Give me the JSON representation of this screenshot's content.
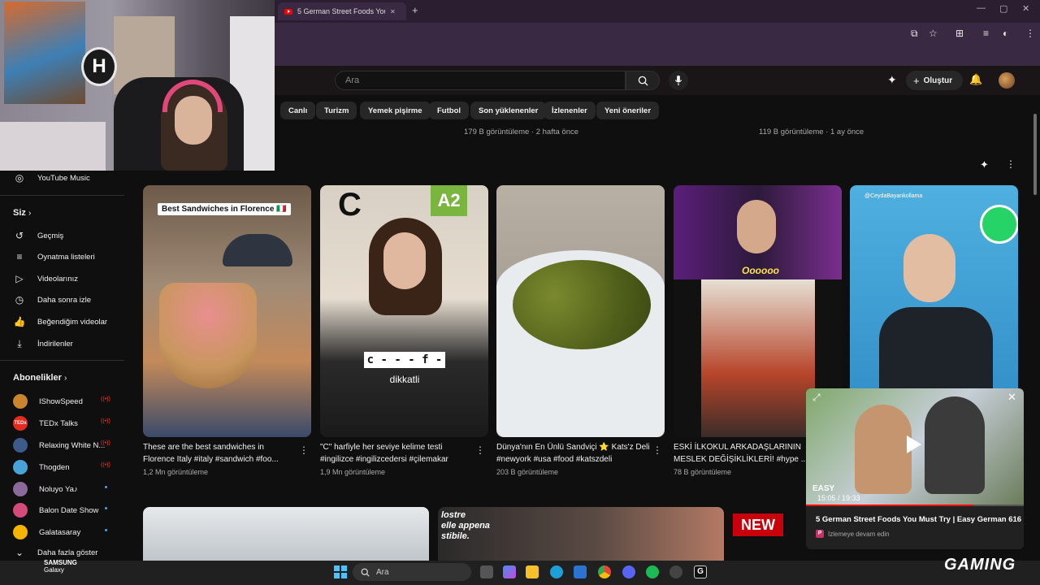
{
  "browser": {
    "tab_title": "5 German Street Foods You Mu",
    "new_tab": "+",
    "close_tab": "✕"
  },
  "youtube": {
    "search_placeholder": "Ara",
    "create_label": "Oluştur",
    "chips": [
      "Canlı",
      "Turizm",
      "Yemek pişirme",
      "Futbol",
      "Son yüklenenler",
      "İzlenenler",
      "Yeni öneriler"
    ],
    "top_meta": [
      "179 B görüntüleme · 2 hafta önce",
      "119 B görüntüleme · 1 ay önce"
    ]
  },
  "sidebar": {
    "youtube_music": "YouTube Music",
    "siz": "Siz",
    "items": [
      "Geçmiş",
      "Oynatma listeleri",
      "Videolarınız",
      "Daha sonra izle",
      "Beğendiğim videolar",
      "İndirilenler"
    ],
    "subs_header": "Abonelikler",
    "subs": [
      "IShowSpeed",
      "TEDx Talks",
      "Relaxing White N...",
      "Thogden",
      "Noluyo Ya♪",
      "Balon Date Show",
      "Galatasaray"
    ],
    "more": "Daha fazla göster"
  },
  "shorts": [
    {
      "overlay": "Best Sandwiches in Florence 🇮🇹",
      "title": "These are the best sandwiches in Florence Italy #italy #sandwich #foo...",
      "views": "1,2 Mn görüntüleme"
    },
    {
      "overlay": "C",
      "badge": "A2",
      "word": "c - - - f - -",
      "word2": "dikkatli",
      "title": "\"C\" harfiyle her seviye kelime testi #ingilizce #ingilizcedersi #çilemakar",
      "views": "1,9 Mn görüntüleme"
    },
    {
      "title": "Dünya'nın En Ünlü Sandviçi ⭐ Kats'z Deli #newyork #usa #food #katszdeli",
      "views": "203 B görüntüleme"
    },
    {
      "overlay": "Oooooo",
      "title": "ESKİ İLKOKUL ARKADAŞLARININ MESLEK DEĞİŞİKLİKLERİ! #hype ...",
      "views": "78 B görüntüleme"
    },
    {
      "overlay": "@CeydaBayankollama"
    }
  ],
  "bottom_row": {
    "new_badge": "NEW",
    "words": "lostre\nelle appena\nstibile."
  },
  "miniplayer": {
    "time": "15:05 / 19:33",
    "title": "5 German Street Foods You Must Try | Easy German 616",
    "badge": "P",
    "sub": "İzlemeye devam edin",
    "easy": "EASY"
  },
  "taskbar": {
    "search": "Ara",
    "brand_line1": "SAMSUNG",
    "brand_line2": "Galaxy",
    "watermark": "GAMING"
  }
}
